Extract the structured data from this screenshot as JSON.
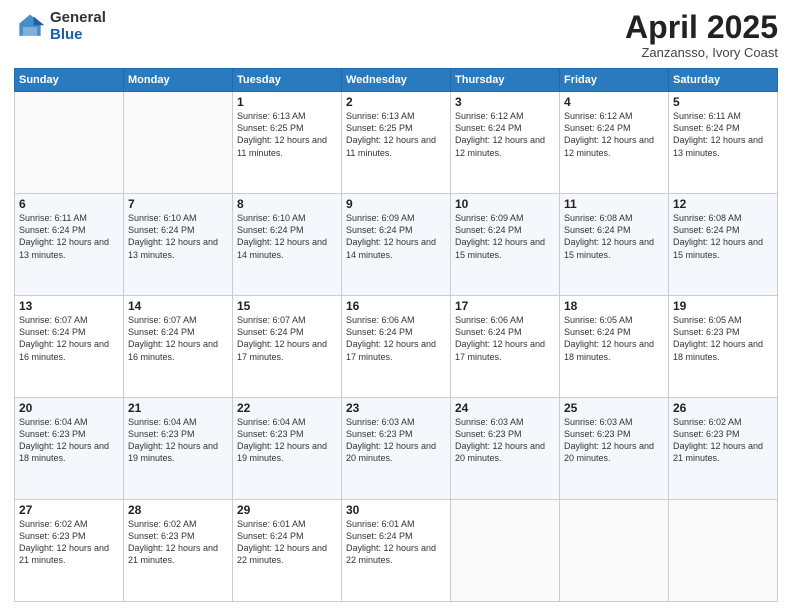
{
  "header": {
    "logo_general": "General",
    "logo_blue": "Blue",
    "month": "April 2025",
    "location": "Zanzansso, Ivory Coast"
  },
  "days_of_week": [
    "Sunday",
    "Monday",
    "Tuesday",
    "Wednesday",
    "Thursday",
    "Friday",
    "Saturday"
  ],
  "weeks": [
    [
      {
        "day": "",
        "info": ""
      },
      {
        "day": "",
        "info": ""
      },
      {
        "day": "1",
        "info": "Sunrise: 6:13 AM\nSunset: 6:25 PM\nDaylight: 12 hours and 11 minutes."
      },
      {
        "day": "2",
        "info": "Sunrise: 6:13 AM\nSunset: 6:25 PM\nDaylight: 12 hours and 11 minutes."
      },
      {
        "day": "3",
        "info": "Sunrise: 6:12 AM\nSunset: 6:24 PM\nDaylight: 12 hours and 12 minutes."
      },
      {
        "day": "4",
        "info": "Sunrise: 6:12 AM\nSunset: 6:24 PM\nDaylight: 12 hours and 12 minutes."
      },
      {
        "day": "5",
        "info": "Sunrise: 6:11 AM\nSunset: 6:24 PM\nDaylight: 12 hours and 13 minutes."
      }
    ],
    [
      {
        "day": "6",
        "info": "Sunrise: 6:11 AM\nSunset: 6:24 PM\nDaylight: 12 hours and 13 minutes."
      },
      {
        "day": "7",
        "info": "Sunrise: 6:10 AM\nSunset: 6:24 PM\nDaylight: 12 hours and 13 minutes."
      },
      {
        "day": "8",
        "info": "Sunrise: 6:10 AM\nSunset: 6:24 PM\nDaylight: 12 hours and 14 minutes."
      },
      {
        "day": "9",
        "info": "Sunrise: 6:09 AM\nSunset: 6:24 PM\nDaylight: 12 hours and 14 minutes."
      },
      {
        "day": "10",
        "info": "Sunrise: 6:09 AM\nSunset: 6:24 PM\nDaylight: 12 hours and 15 minutes."
      },
      {
        "day": "11",
        "info": "Sunrise: 6:08 AM\nSunset: 6:24 PM\nDaylight: 12 hours and 15 minutes."
      },
      {
        "day": "12",
        "info": "Sunrise: 6:08 AM\nSunset: 6:24 PM\nDaylight: 12 hours and 15 minutes."
      }
    ],
    [
      {
        "day": "13",
        "info": "Sunrise: 6:07 AM\nSunset: 6:24 PM\nDaylight: 12 hours and 16 minutes."
      },
      {
        "day": "14",
        "info": "Sunrise: 6:07 AM\nSunset: 6:24 PM\nDaylight: 12 hours and 16 minutes."
      },
      {
        "day": "15",
        "info": "Sunrise: 6:07 AM\nSunset: 6:24 PM\nDaylight: 12 hours and 17 minutes."
      },
      {
        "day": "16",
        "info": "Sunrise: 6:06 AM\nSunset: 6:24 PM\nDaylight: 12 hours and 17 minutes."
      },
      {
        "day": "17",
        "info": "Sunrise: 6:06 AM\nSunset: 6:24 PM\nDaylight: 12 hours and 17 minutes."
      },
      {
        "day": "18",
        "info": "Sunrise: 6:05 AM\nSunset: 6:24 PM\nDaylight: 12 hours and 18 minutes."
      },
      {
        "day": "19",
        "info": "Sunrise: 6:05 AM\nSunset: 6:23 PM\nDaylight: 12 hours and 18 minutes."
      }
    ],
    [
      {
        "day": "20",
        "info": "Sunrise: 6:04 AM\nSunset: 6:23 PM\nDaylight: 12 hours and 18 minutes."
      },
      {
        "day": "21",
        "info": "Sunrise: 6:04 AM\nSunset: 6:23 PM\nDaylight: 12 hours and 19 minutes."
      },
      {
        "day": "22",
        "info": "Sunrise: 6:04 AM\nSunset: 6:23 PM\nDaylight: 12 hours and 19 minutes."
      },
      {
        "day": "23",
        "info": "Sunrise: 6:03 AM\nSunset: 6:23 PM\nDaylight: 12 hours and 20 minutes."
      },
      {
        "day": "24",
        "info": "Sunrise: 6:03 AM\nSunset: 6:23 PM\nDaylight: 12 hours and 20 minutes."
      },
      {
        "day": "25",
        "info": "Sunrise: 6:03 AM\nSunset: 6:23 PM\nDaylight: 12 hours and 20 minutes."
      },
      {
        "day": "26",
        "info": "Sunrise: 6:02 AM\nSunset: 6:23 PM\nDaylight: 12 hours and 21 minutes."
      }
    ],
    [
      {
        "day": "27",
        "info": "Sunrise: 6:02 AM\nSunset: 6:23 PM\nDaylight: 12 hours and 21 minutes."
      },
      {
        "day": "28",
        "info": "Sunrise: 6:02 AM\nSunset: 6:23 PM\nDaylight: 12 hours and 21 minutes."
      },
      {
        "day": "29",
        "info": "Sunrise: 6:01 AM\nSunset: 6:24 PM\nDaylight: 12 hours and 22 minutes."
      },
      {
        "day": "30",
        "info": "Sunrise: 6:01 AM\nSunset: 6:24 PM\nDaylight: 12 hours and 22 minutes."
      },
      {
        "day": "",
        "info": ""
      },
      {
        "day": "",
        "info": ""
      },
      {
        "day": "",
        "info": ""
      }
    ]
  ]
}
